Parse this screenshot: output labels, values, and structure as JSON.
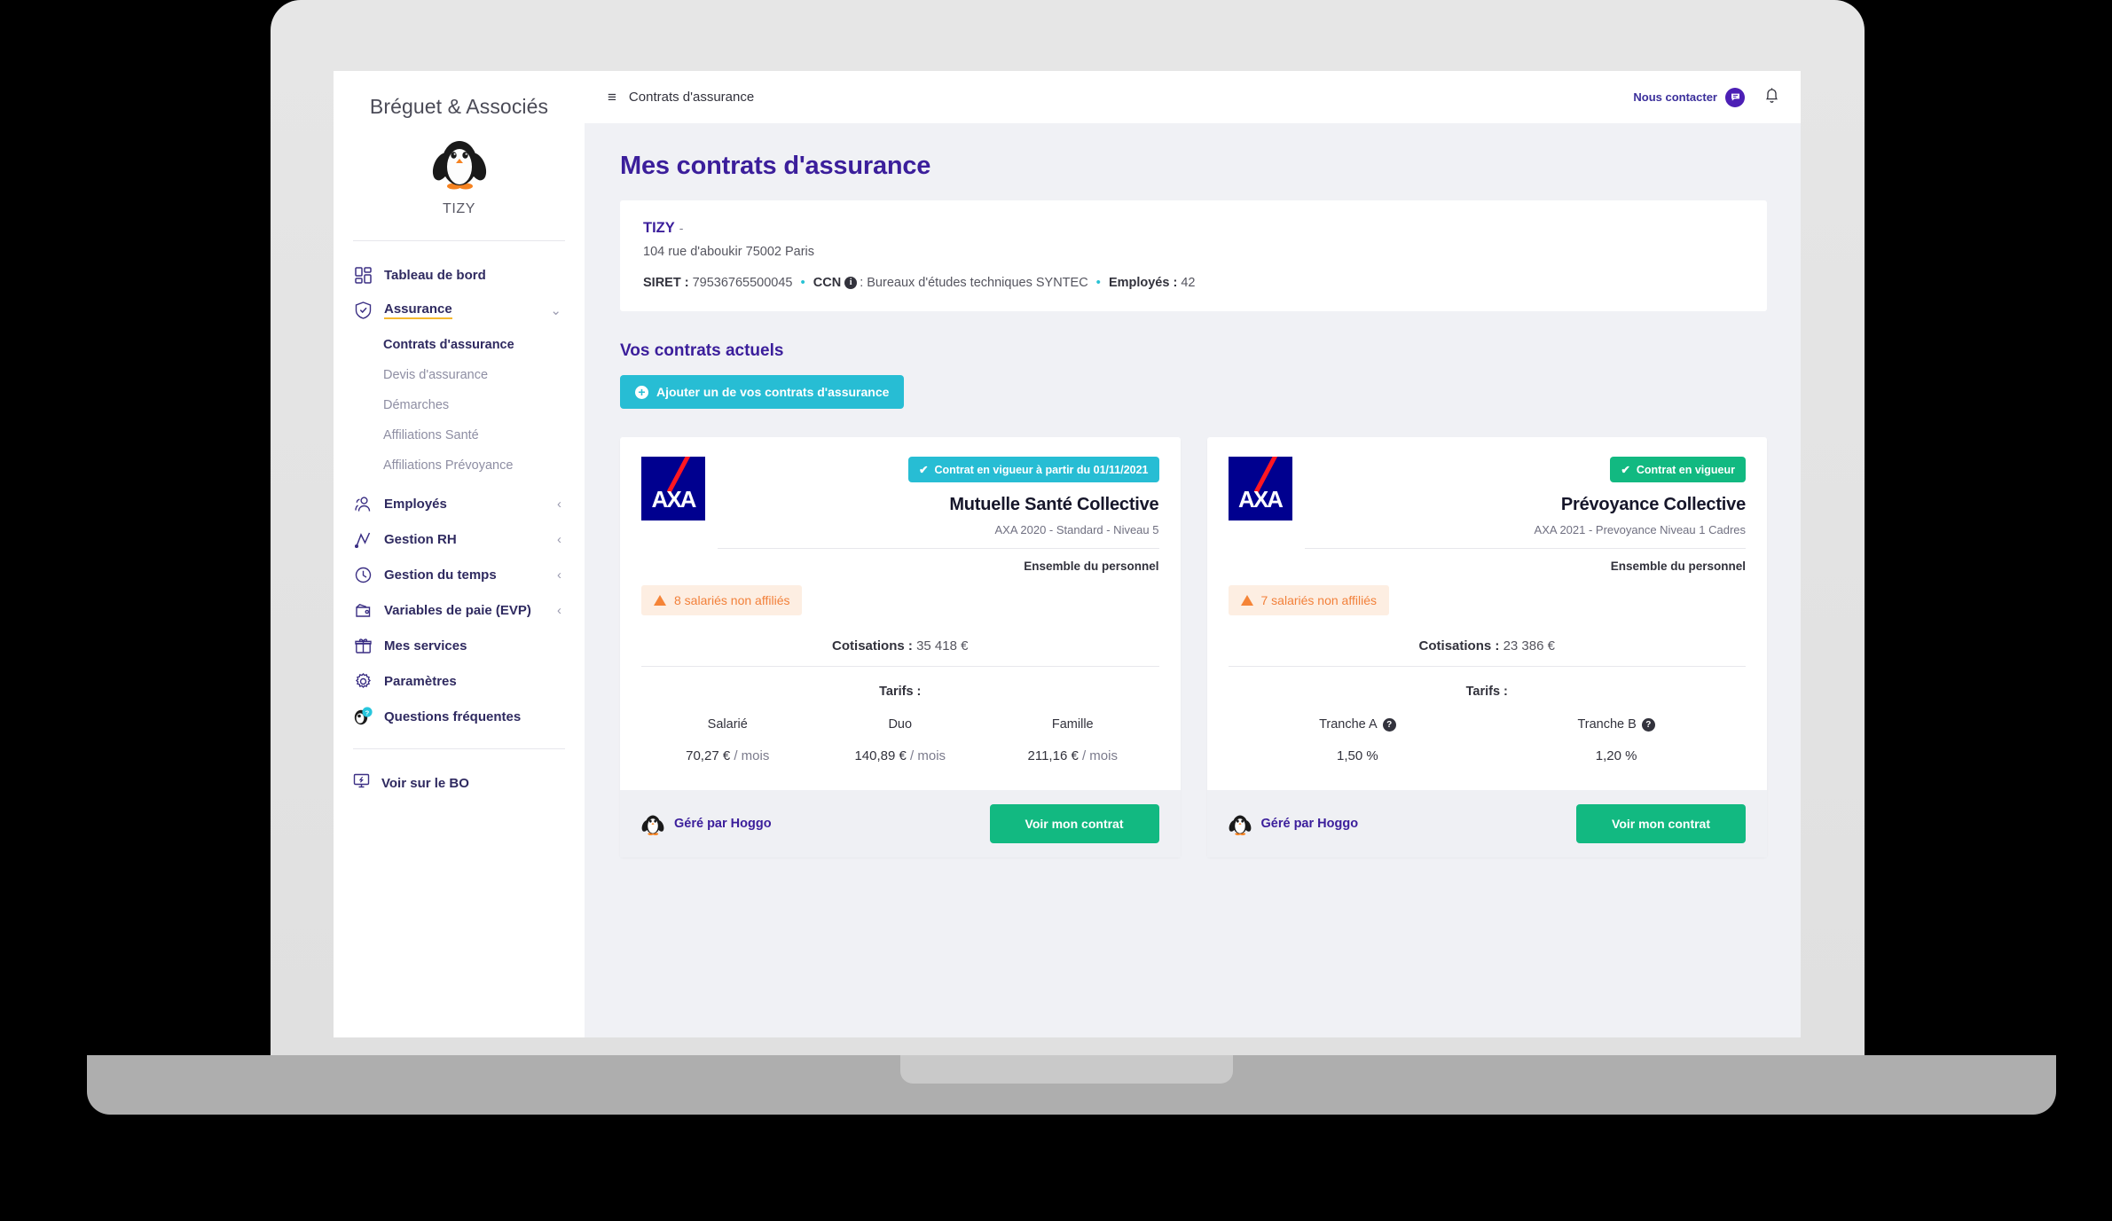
{
  "sidebar": {
    "brand_title": "Bréguet & Associés",
    "brand_sub": "TIZY",
    "items": [
      {
        "label": "Tableau de bord",
        "icon": "dashboard-icon"
      },
      {
        "label": "Assurance",
        "icon": "shield-check-icon",
        "chevron": "⌄"
      },
      {
        "label": "Employés",
        "icon": "users-icon",
        "chevron": "‹"
      },
      {
        "label": "Gestion RH",
        "icon": "chart-line-icon",
        "chevron": "‹"
      },
      {
        "label": "Gestion du temps",
        "icon": "clock-icon",
        "chevron": "‹"
      },
      {
        "label": "Variables de paie (EVP)",
        "icon": "wallet-icon",
        "chevron": "‹"
      },
      {
        "label": "Mes services",
        "icon": "gift-icon"
      },
      {
        "label": "Paramètres",
        "icon": "gear-icon"
      },
      {
        "label": "Questions fréquentes",
        "icon": "penguin-help-icon"
      }
    ],
    "subitems": [
      {
        "label": "Contrats d'assurance"
      },
      {
        "label": "Devis d'assurance"
      },
      {
        "label": "Démarches"
      },
      {
        "label": "Affiliations Santé"
      },
      {
        "label": "Affiliations Prévoyance"
      }
    ],
    "bo_link": "Voir sur le BO"
  },
  "topbar": {
    "title": "Contrats d'assurance",
    "contact_label": "Nous contacter"
  },
  "main": {
    "page_title": "Mes contrats d'assurance",
    "company": {
      "name": "TIZY",
      "name_suffix": "-",
      "address": "104 rue d'aboukir 75002 Paris",
      "siret_label": "SIRET :",
      "siret_value": "79536765500045",
      "ccn_label": "CCN",
      "ccn_sep": ":",
      "ccn_value": "Bureaux d'études techniques SYNTEC",
      "employes_label": "Employés :",
      "employes_value": "42"
    },
    "section_title": "Vos contrats actuels",
    "add_button": "Ajouter un de vos contrats d'assurance",
    "contracts": [
      {
        "logo": "AXA",
        "badge": "Contrat en vigueur à partir du 01/11/2021",
        "badge_style": "cyan",
        "name": "Mutuelle Santé Collective",
        "sub": "AXA 2020 - Standard - Niveau 5",
        "scope": "Ensemble du personnel",
        "warning": "8 salariés non affiliés",
        "cotis_label": "Cotisations :",
        "cotis_value": "35 418 €",
        "tarifs_label": "Tarifs :",
        "tarifs": [
          {
            "head": "Salarié",
            "value": "70,27 €",
            "unit": "/ mois",
            "help": false
          },
          {
            "head": "Duo",
            "value": "140,89 €",
            "unit": "/ mois",
            "help": false
          },
          {
            "head": "Famille",
            "value": "211,16 €",
            "unit": "/ mois",
            "help": false
          }
        ],
        "managed_by": "Géré par Hoggo",
        "cta": "Voir mon contrat"
      },
      {
        "logo": "AXA",
        "badge": "Contrat en vigueur",
        "badge_style": "green",
        "name": "Prévoyance Collective",
        "sub": "AXA 2021 - Prevoyance Niveau 1 Cadres",
        "scope": "Ensemble du personnel",
        "warning": "7 salariés non affiliés",
        "cotis_label": "Cotisations :",
        "cotis_value": "23 386 €",
        "tarifs_label": "Tarifs :",
        "tarifs": [
          {
            "head": "Tranche A",
            "value": "1,50 %",
            "unit": "",
            "help": true
          },
          {
            "head": "Tranche B",
            "value": "1,20 %",
            "unit": "",
            "help": true
          }
        ],
        "managed_by": "Géré par Hoggo",
        "cta": "Voir mon contrat"
      }
    ]
  },
  "colors": {
    "brand_purple": "#3b1e9b",
    "accent_cyan": "#27bdd4",
    "accent_green": "#12b981",
    "warning_orange": "#f2803a",
    "active_underline": "#f5b82e",
    "axa_blue": "#00008f",
    "axa_red": "#ff1721"
  },
  "icons": {
    "burger": "≡",
    "check": "✔",
    "plus": "+",
    "info": "i",
    "help": "?",
    "bullet": "•"
  }
}
